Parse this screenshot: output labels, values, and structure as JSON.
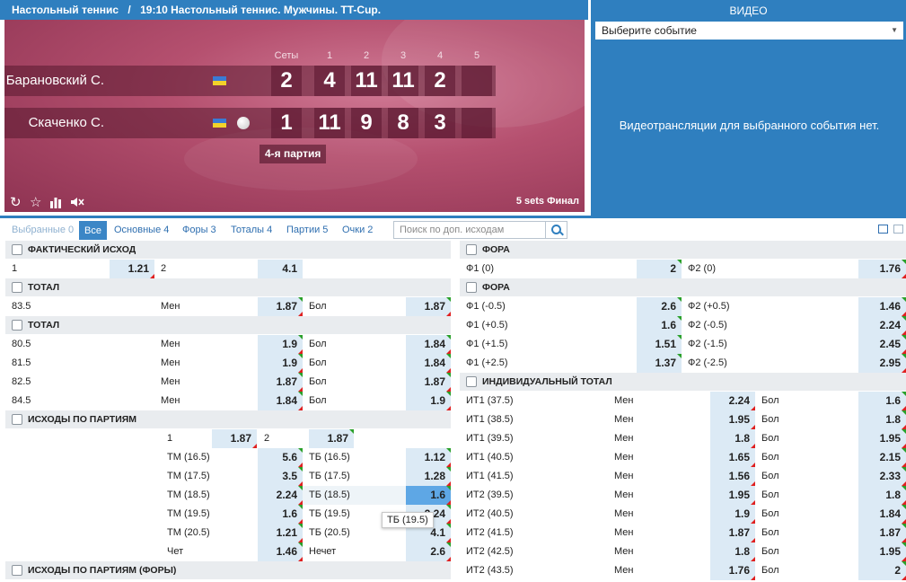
{
  "header": {
    "sport": "Настольный теннис",
    "separator": "/",
    "event": "19:10 Настольный теннис. Мужчины. TT-Cup."
  },
  "scoreboard": {
    "col_headers": [
      "Сеты",
      "1",
      "2",
      "3",
      "4",
      "5"
    ],
    "players": [
      {
        "name": "Барановский С.",
        "sets": "2",
        "games": [
          "4",
          "11",
          "11",
          "2",
          ""
        ],
        "serving": false
      },
      {
        "name": "Скаченко С.",
        "sets": "1",
        "games": [
          "11",
          "9",
          "8",
          "3",
          ""
        ],
        "serving": true
      }
    ],
    "current_part": "4-я партия",
    "format": "5 sets Финал",
    "controls": [
      "refresh-icon",
      "star-icon",
      "stats-icon",
      "mute-icon"
    ]
  },
  "video": {
    "title": "ВИДЕО",
    "select_value": "Выберите событие",
    "message": "Видеотрансляции для выбранного события нет."
  },
  "tabs": [
    {
      "label": "Выбранные 0",
      "state": "dim"
    },
    {
      "label": "Все",
      "state": "active"
    },
    {
      "label": "Основные 4",
      "state": "normal"
    },
    {
      "label": "Форы 3",
      "state": "normal"
    },
    {
      "label": "Тоталы 4",
      "state": "normal"
    },
    {
      "label": "Партии 5",
      "state": "normal"
    },
    {
      "label": "Очки 2",
      "state": "normal"
    }
  ],
  "search": {
    "placeholder": "Поиск по доп. исходам"
  },
  "tooltip": "ТБ (19.5)",
  "left": [
    {
      "type": "section",
      "title": "ФАКТИЧЕСКИЙ ИСХОД"
    },
    {
      "type": "r2",
      "c": [
        "1",
        "1.21",
        "2",
        "4.1"
      ]
    },
    {
      "type": "section",
      "title": "ТОТАЛ"
    },
    {
      "type": "r3",
      "c": [
        "83.5",
        "Мен",
        "1.87",
        "Бол",
        "1.87"
      ]
    },
    {
      "type": "section",
      "title": "ТОТАЛ"
    },
    {
      "type": "r3",
      "c": [
        "80.5",
        "Мен",
        "1.9",
        "Бол",
        "1.84"
      ]
    },
    {
      "type": "r3",
      "c": [
        "81.5",
        "Мен",
        "1.9",
        "Бол",
        "1.84"
      ]
    },
    {
      "type": "r3",
      "c": [
        "82.5",
        "Мен",
        "1.87",
        "Бол",
        "1.87"
      ]
    },
    {
      "type": "r3",
      "c": [
        "84.5",
        "Мен",
        "1.84",
        "Бол",
        "1.9"
      ]
    },
    {
      "type": "section",
      "title": "ИСХОДЫ ПО ПАРТИЯМ"
    },
    {
      "type": "part",
      "label": "4-я партия",
      "rows": [
        {
          "k": "w",
          "c": [
            "1",
            "1.87",
            "2",
            "1.87"
          ]
        },
        {
          "k": "t",
          "c": [
            "ТМ (16.5)",
            "5.6",
            "ТБ (16.5)",
            "1.12"
          ]
        },
        {
          "k": "t",
          "c": [
            "ТМ (17.5)",
            "3.5",
            "ТБ (17.5)",
            "1.28"
          ]
        },
        {
          "k": "t",
          "c": [
            "ТМ (18.5)",
            "2.24",
            "ТБ (18.5)",
            "1.6"
          ],
          "hl": true
        },
        {
          "k": "t",
          "c": [
            "ТМ (19.5)",
            "1.6",
            "ТБ (19.5)",
            "2.24"
          ]
        },
        {
          "k": "t",
          "c": [
            "ТМ (20.5)",
            "1.21",
            "ТБ (20.5)",
            "4.1"
          ]
        },
        {
          "k": "t",
          "c": [
            "Чет",
            "1.46",
            "Нечет",
            "2.6"
          ]
        }
      ]
    },
    {
      "type": "section",
      "title": "ИСХОДЫ ПО ПАРТИЯМ (ФОРЫ)"
    }
  ],
  "right": [
    {
      "type": "section",
      "title": "ФОРА"
    },
    {
      "type": "r4",
      "c": [
        "Ф1 (0)",
        "2",
        "Ф2 (0)",
        "1.76"
      ]
    },
    {
      "type": "section",
      "title": "ФОРА"
    },
    {
      "type": "r4",
      "c": [
        "Ф1 (-0.5)",
        "2.6",
        "Ф2 (+0.5)",
        "1.46"
      ]
    },
    {
      "type": "r4",
      "c": [
        "Ф1 (+0.5)",
        "1.6",
        "Ф2 (-0.5)",
        "2.24"
      ]
    },
    {
      "type": "r4",
      "c": [
        "Ф1 (+1.5)",
        "1.51",
        "Ф2 (-1.5)",
        "2.45"
      ]
    },
    {
      "type": "r4",
      "c": [
        "Ф1 (+2.5)",
        "1.37",
        "Ф2 (-2.5)",
        "2.95"
      ]
    },
    {
      "type": "section",
      "title": "ИНДИВИДУАЛЬНЫЙ ТОТАЛ"
    },
    {
      "type": "r5",
      "c": [
        "ИТ1 (37.5)",
        "Мен",
        "2.24",
        "Бол",
        "1.6"
      ]
    },
    {
      "type": "r5",
      "c": [
        "ИТ1 (38.5)",
        "Мен",
        "1.95",
        "Бол",
        "1.8"
      ]
    },
    {
      "type": "r5",
      "c": [
        "ИТ1 (39.5)",
        "Мен",
        "1.8",
        "Бол",
        "1.95"
      ]
    },
    {
      "type": "r5",
      "c": [
        "ИТ1 (40.5)",
        "Мен",
        "1.65",
        "Бол",
        "2.15"
      ]
    },
    {
      "type": "r5",
      "c": [
        "ИТ1 (41.5)",
        "Мен",
        "1.56",
        "Бол",
        "2.33"
      ]
    },
    {
      "type": "r5",
      "c": [
        "ИТ2 (39.5)",
        "Мен",
        "1.95",
        "Бол",
        "1.8"
      ]
    },
    {
      "type": "r5",
      "c": [
        "ИТ2 (40.5)",
        "Мен",
        "1.9",
        "Бол",
        "1.84"
      ]
    },
    {
      "type": "r5",
      "c": [
        "ИТ2 (41.5)",
        "Мен",
        "1.87",
        "Бол",
        "1.87"
      ]
    },
    {
      "type": "r5",
      "c": [
        "ИТ2 (42.5)",
        "Мен",
        "1.8",
        "Бол",
        "1.95"
      ]
    },
    {
      "type": "r5",
      "c": [
        "ИТ2 (43.5)",
        "Мен",
        "1.76",
        "Бол",
        "2"
      ]
    }
  ]
}
